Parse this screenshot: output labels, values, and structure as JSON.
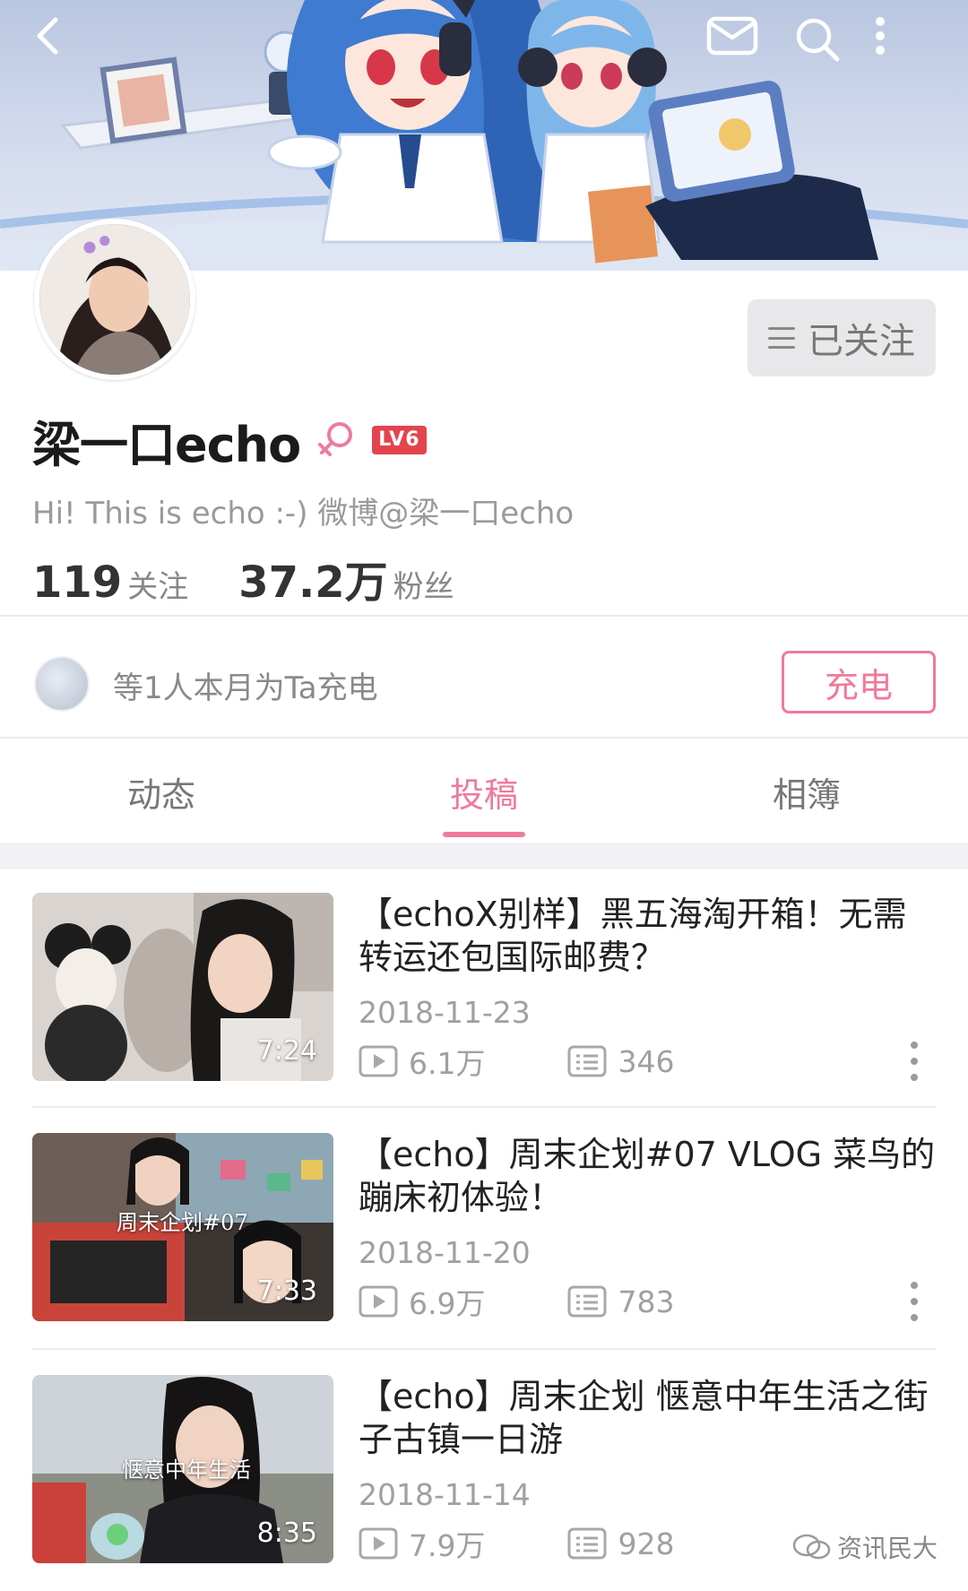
{
  "header": {
    "back_icon": "chevron-left-icon",
    "mail_icon": "mail-icon",
    "search_icon": "search-icon",
    "more_icon": "vertical-dots-icon"
  },
  "profile": {
    "username": "梁一口echo",
    "gender_icon": "female-icon",
    "level": "LV6",
    "bio": "Hi! This is echo :-) 微博@梁一口echo",
    "following_count": "119",
    "following_label": "关注",
    "followers_count": "37.2万",
    "followers_label": "粉丝",
    "follow_button_label": "已关注"
  },
  "charge": {
    "text": "等1人本月为Ta充电",
    "button_label": "充电"
  },
  "tabs": [
    {
      "label": "动态",
      "active": false
    },
    {
      "label": "投稿",
      "active": true
    },
    {
      "label": "相簿",
      "active": false
    }
  ],
  "videos": [
    {
      "title": "【echoX别样】黑五海淘开箱！无需转运还包国际邮费？",
      "date": "2018-11-23",
      "views": "6.1万",
      "comments": "346",
      "duration": "7:24",
      "caption": ""
    },
    {
      "title": "【echo】周末企划#07 VLOG 菜鸟的蹦床初体验！",
      "date": "2018-11-20",
      "views": "6.9万",
      "comments": "783",
      "duration": "7:33",
      "caption": "周末企划#07"
    },
    {
      "title": "【echo】周末企划 惬意中年生活之街子古镇一日游",
      "date": "2018-11-14",
      "views": "7.9万",
      "comments": "928",
      "duration": "8:35",
      "caption": "惬意中年生活"
    }
  ],
  "watermark": {
    "text": "资讯民大"
  },
  "colors": {
    "accent_pink": "#f07a9c",
    "level_red": "#e3444d",
    "follow_gray": "#e8e8ea"
  }
}
